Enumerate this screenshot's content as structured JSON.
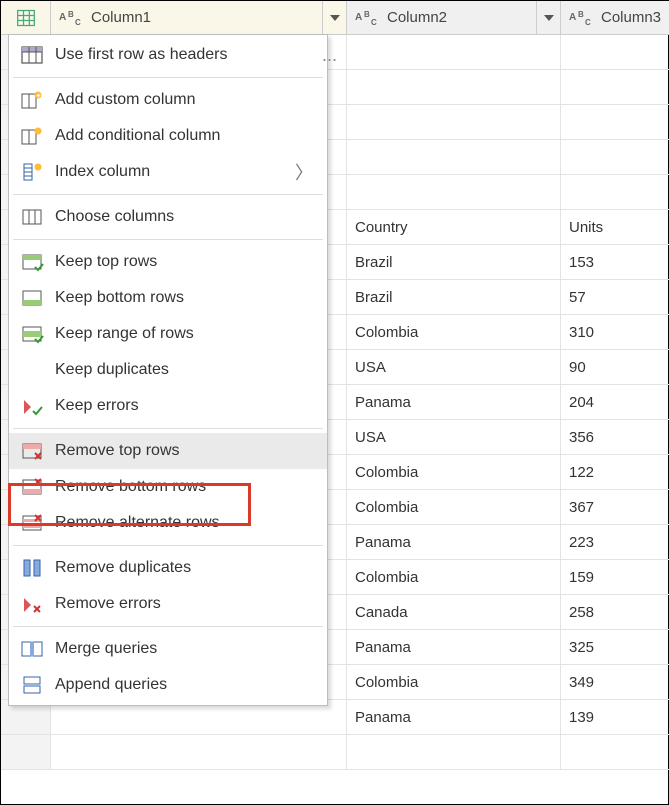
{
  "columns": {
    "col1": "Column1",
    "col2": "Column2",
    "col3": "Column3"
  },
  "partial_ellipsis": "...",
  "table_rows": [
    {
      "idx": "",
      "c1": "",
      "c2": "",
      "c3": ""
    },
    {
      "idx": "",
      "c1": "",
      "c2": "",
      "c3": ""
    },
    {
      "idx": "",
      "c1": "",
      "c2": "",
      "c3": ""
    },
    {
      "idx": "",
      "c1": "",
      "c2": "",
      "c3": ""
    },
    {
      "idx": "",
      "c1": "",
      "c2": "",
      "c3": ""
    },
    {
      "idx": "",
      "c1": "",
      "c2": "Country",
      "c3": "Units"
    },
    {
      "idx": "",
      "c1": "",
      "c2": "Brazil",
      "c3": "153"
    },
    {
      "idx": "",
      "c1": "",
      "c2": "Brazil",
      "c3": "57"
    },
    {
      "idx": "",
      "c1": "",
      "c2": "Colombia",
      "c3": "310"
    },
    {
      "idx": "",
      "c1": "",
      "c2": "USA",
      "c3": "90"
    },
    {
      "idx": "",
      "c1": "",
      "c2": "Panama",
      "c3": "204"
    },
    {
      "idx": "",
      "c1": "",
      "c2": "USA",
      "c3": "356"
    },
    {
      "idx": "",
      "c1": "",
      "c2": "Colombia",
      "c3": "122"
    },
    {
      "idx": "",
      "c1": "",
      "c2": "Colombia",
      "c3": "367"
    },
    {
      "idx": "",
      "c1": "",
      "c2": "Panama",
      "c3": "223"
    },
    {
      "idx": "",
      "c1": "",
      "c2": "Colombia",
      "c3": "159"
    },
    {
      "idx": "",
      "c1": "",
      "c2": "Canada",
      "c3": "258"
    },
    {
      "idx": "",
      "c1": "",
      "c2": "Panama",
      "c3": "325"
    },
    {
      "idx": "",
      "c1": "",
      "c2": "Colombia",
      "c3": "349"
    },
    {
      "idx": "",
      "c1": "",
      "c2": "Panama",
      "c3": "139"
    },
    {
      "idx": "",
      "c1": "",
      "c2": "",
      "c3": ""
    }
  ],
  "menu": {
    "use_first_row": "Use first row as headers",
    "add_custom_col": "Add custom column",
    "add_conditional_col": "Add conditional column",
    "index_column": "Index column",
    "choose_columns": "Choose columns",
    "keep_top": "Keep top rows",
    "keep_bottom": "Keep bottom rows",
    "keep_range": "Keep range of rows",
    "keep_duplicates": "Keep duplicates",
    "keep_errors": "Keep errors",
    "remove_top": "Remove top rows",
    "remove_bottom": "Remove bottom rows",
    "remove_alternate": "Remove alternate rows",
    "remove_duplicates": "Remove duplicates",
    "remove_errors": "Remove errors",
    "merge_queries": "Merge queries",
    "append_queries": "Append queries"
  }
}
